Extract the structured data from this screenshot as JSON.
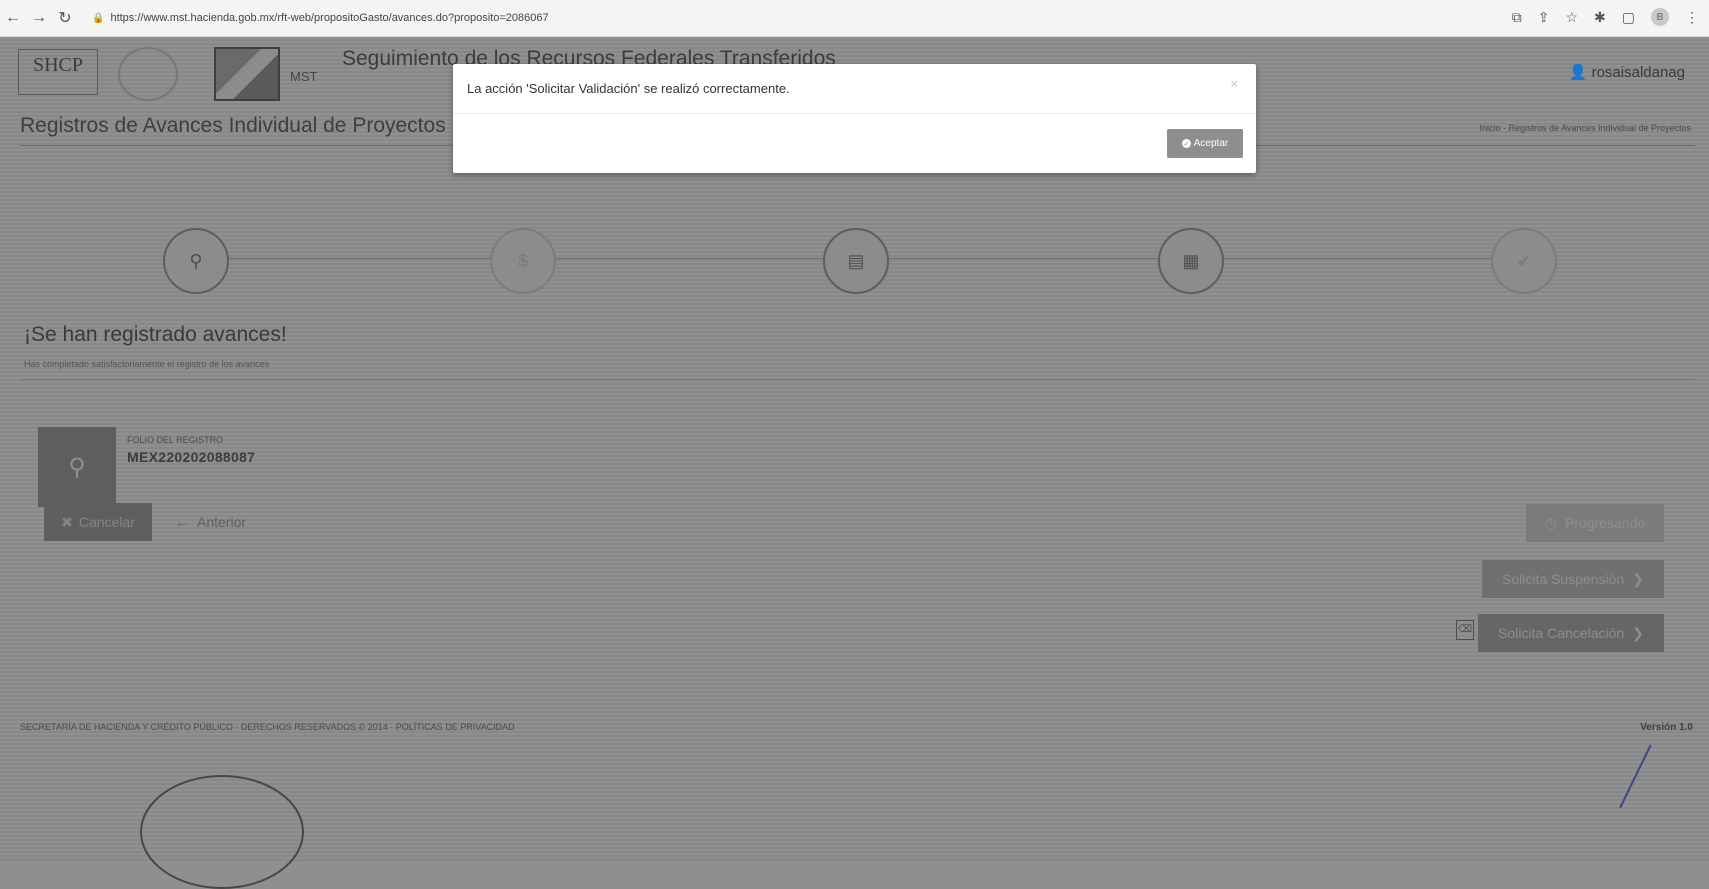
{
  "browser": {
    "url": "https://www.mst.hacienda.gob.mx/rft-web/propositoGasto/avances.do?proposito=2086067",
    "profile_initial": "B"
  },
  "header": {
    "org_logo_text": "SHCP",
    "mst_label": "MST",
    "system_title": "Seguimiento de los Recursos Federales Transferidos",
    "user": "rosaisaldanag"
  },
  "page": {
    "title": "Registros de Avances Individual de Proyectos",
    "breadcrumb": "Inicio  ·  Registros de Avances Individual de Proyectos"
  },
  "steps": [
    {
      "icon": "map-marker-icon"
    },
    {
      "icon": "dollar-icon"
    },
    {
      "icon": "document-icon"
    },
    {
      "icon": "file-chart-icon"
    },
    {
      "icon": "check-icon"
    }
  ],
  "success": {
    "title": "¡Se han registrado avances!",
    "subtitle": "Has completado satisfactoriamente el registro de los avances"
  },
  "folio": {
    "label": "FOLIO DEL REGISTRO",
    "value": "MEX220202088087"
  },
  "actions": {
    "cancelar": "Cancelar",
    "anterior": "Anterior",
    "progreso": "Progresando",
    "solicita_suspension": "Solicita Suspensión",
    "solicita_cancelacion": "Solicita Cancelación"
  },
  "footer": {
    "text": "SECRETARÍA DE HACIENDA Y CRÉDITO PÚBLICO · DERECHOS RESERVADOS © 2014 · POLÍTICAS DE PRIVACIDAD",
    "version": "Versión 1.0"
  },
  "modal": {
    "message": "La acción 'Solicitar Validación' se realizó correctamente.",
    "close": "×",
    "accept": "Aceptar"
  }
}
